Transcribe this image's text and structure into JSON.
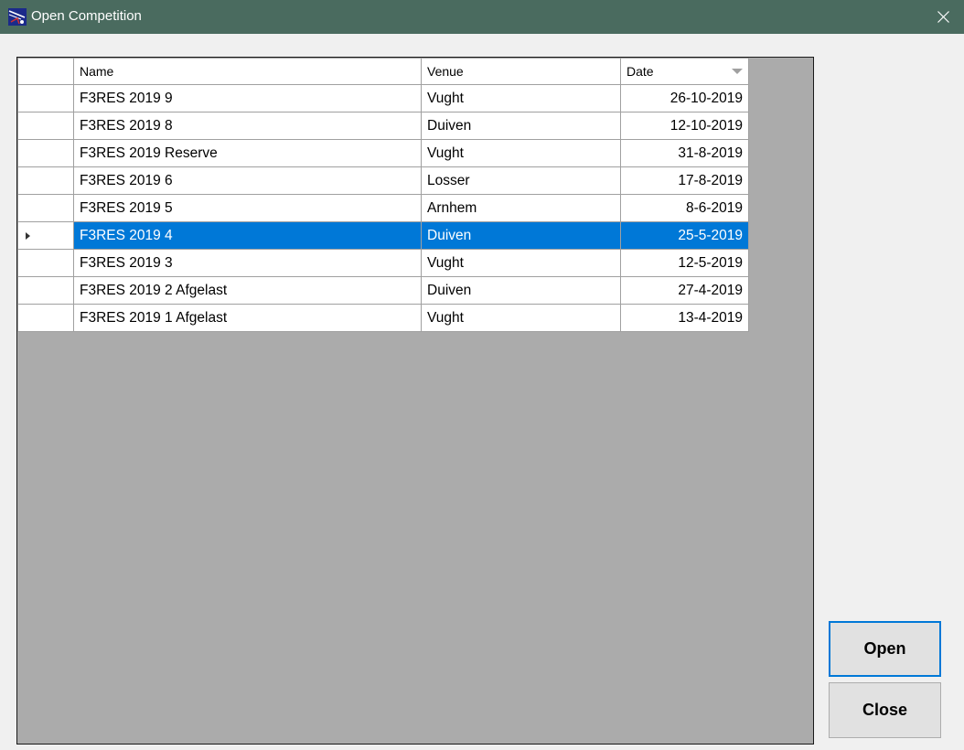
{
  "window": {
    "title": "Open Competition",
    "title_bar_color": "#4a6b5f",
    "icon": "app-logo-icon"
  },
  "grid": {
    "columns": [
      "Name",
      "Venue",
      "Date"
    ],
    "sorted_column": "Date",
    "sort_direction": "descending",
    "selected_row_index": 5,
    "selection_color": "#0078d7",
    "rows": [
      {
        "name": "F3RES 2019 9",
        "venue": "Vught",
        "date": "26-10-2019"
      },
      {
        "name": "F3RES 2019 8",
        "venue": "Duiven",
        "date": "12-10-2019"
      },
      {
        "name": "F3RES 2019 Reserve",
        "venue": "Vught",
        "date": "31-8-2019"
      },
      {
        "name": "F3RES 2019 6",
        "venue": "Losser",
        "date": "17-8-2019"
      },
      {
        "name": "F3RES 2019 5",
        "venue": "Arnhem",
        "date": "8-6-2019"
      },
      {
        "name": "F3RES 2019 4",
        "venue": "Duiven",
        "date": "25-5-2019"
      },
      {
        "name": "F3RES 2019 3",
        "venue": "Vught",
        "date": "12-5-2019"
      },
      {
        "name": "F3RES 2019 2 Afgelast",
        "venue": "Duiven",
        "date": "27-4-2019"
      },
      {
        "name": "F3RES 2019 1 Afgelast",
        "venue": "Vught",
        "date": "13-4-2019"
      }
    ]
  },
  "buttons": {
    "open_label": "Open",
    "close_label": "Close"
  }
}
